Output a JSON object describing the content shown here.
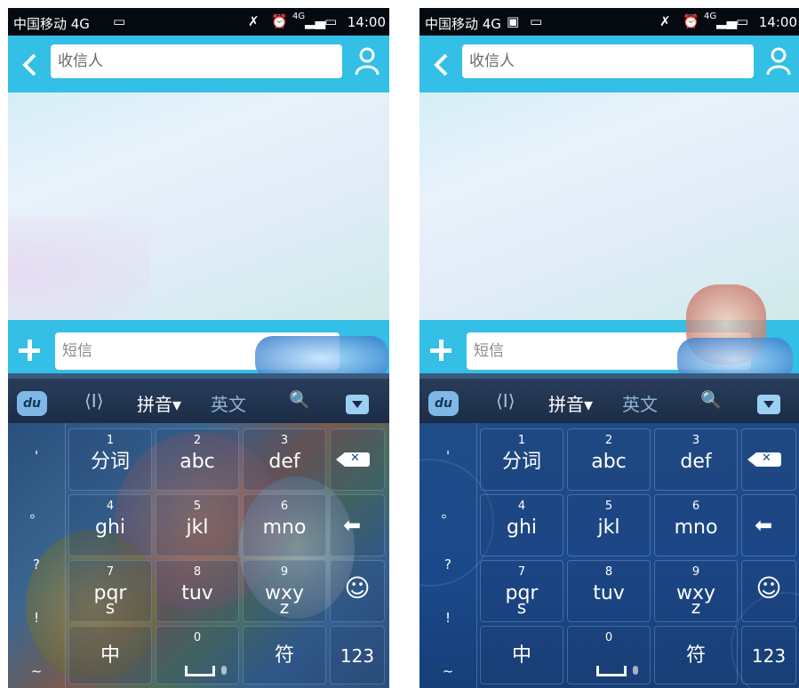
{
  "status_bar": {
    "carrier": "中国移动 4G",
    "signal_tag": "4G",
    "time": "14:00"
  },
  "header": {
    "recipient_placeholder": "收信人"
  },
  "composer": {
    "sms_placeholder": "短信"
  },
  "keyboard": {
    "toolbar": {
      "logo": "du",
      "cursor_glyph": "⟨I⟩",
      "pinyin_label": "拼音▾",
      "english_label": "英文",
      "search_glyph": "🔍"
    },
    "symbols": [
      "'",
      "。",
      "?",
      "!",
      "~"
    ],
    "keys": [
      {
        "num": "1",
        "label": "分词",
        "label2": ""
      },
      {
        "num": "2",
        "label": "abc",
        "label2": ""
      },
      {
        "num": "3",
        "label": "def",
        "label2": ""
      },
      {
        "num": "4",
        "label": "ghi",
        "label2": ""
      },
      {
        "num": "5",
        "label": "jkl",
        "label2": ""
      },
      {
        "num": "6",
        "label": "mno",
        "label2": ""
      },
      {
        "num": "7",
        "label": "pqr",
        "label2": "s"
      },
      {
        "num": "8",
        "label": "tuv",
        "label2": ""
      },
      {
        "num": "9",
        "label": "wxy",
        "label2": "z"
      }
    ],
    "bottom_row": {
      "chinese_label": "中",
      "space_num": "0",
      "symbol_label": "符",
      "numeric_label": "123"
    },
    "emoji_glyph": "☺"
  }
}
